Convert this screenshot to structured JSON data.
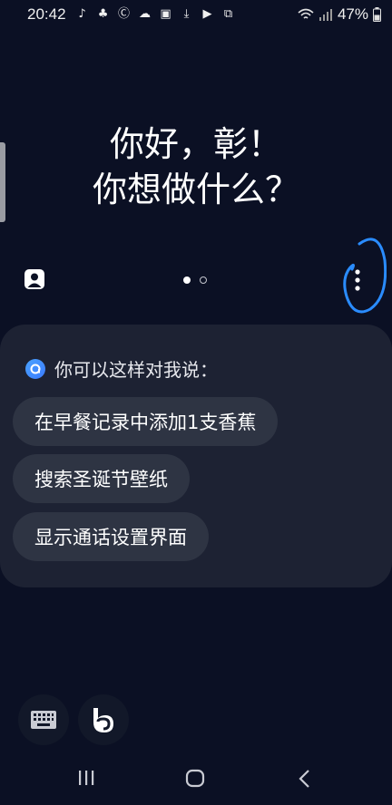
{
  "status_bar": {
    "time": "20:42",
    "notification_icons": [
      "tiktok-icon",
      "bixby-icon",
      "c-icon",
      "cloud-icon",
      "image-icon",
      "download-icon",
      "video-icon",
      "translate-icon"
    ],
    "battery": "47%"
  },
  "greeting": {
    "line1": "你好，彰！",
    "line2": "你想做什么？"
  },
  "pager": {
    "total": 2,
    "current": 1
  },
  "suggestions": {
    "header": "你可以这样对我说：",
    "items": [
      "在早餐记录中添加1支香蕉",
      "搜索圣诞节壁纸",
      "显示通话设置界面"
    ]
  },
  "colors": {
    "background": "#0b1024",
    "card": "#1d2233",
    "chip": "#2e3443",
    "annotation": "#2a8cff"
  }
}
